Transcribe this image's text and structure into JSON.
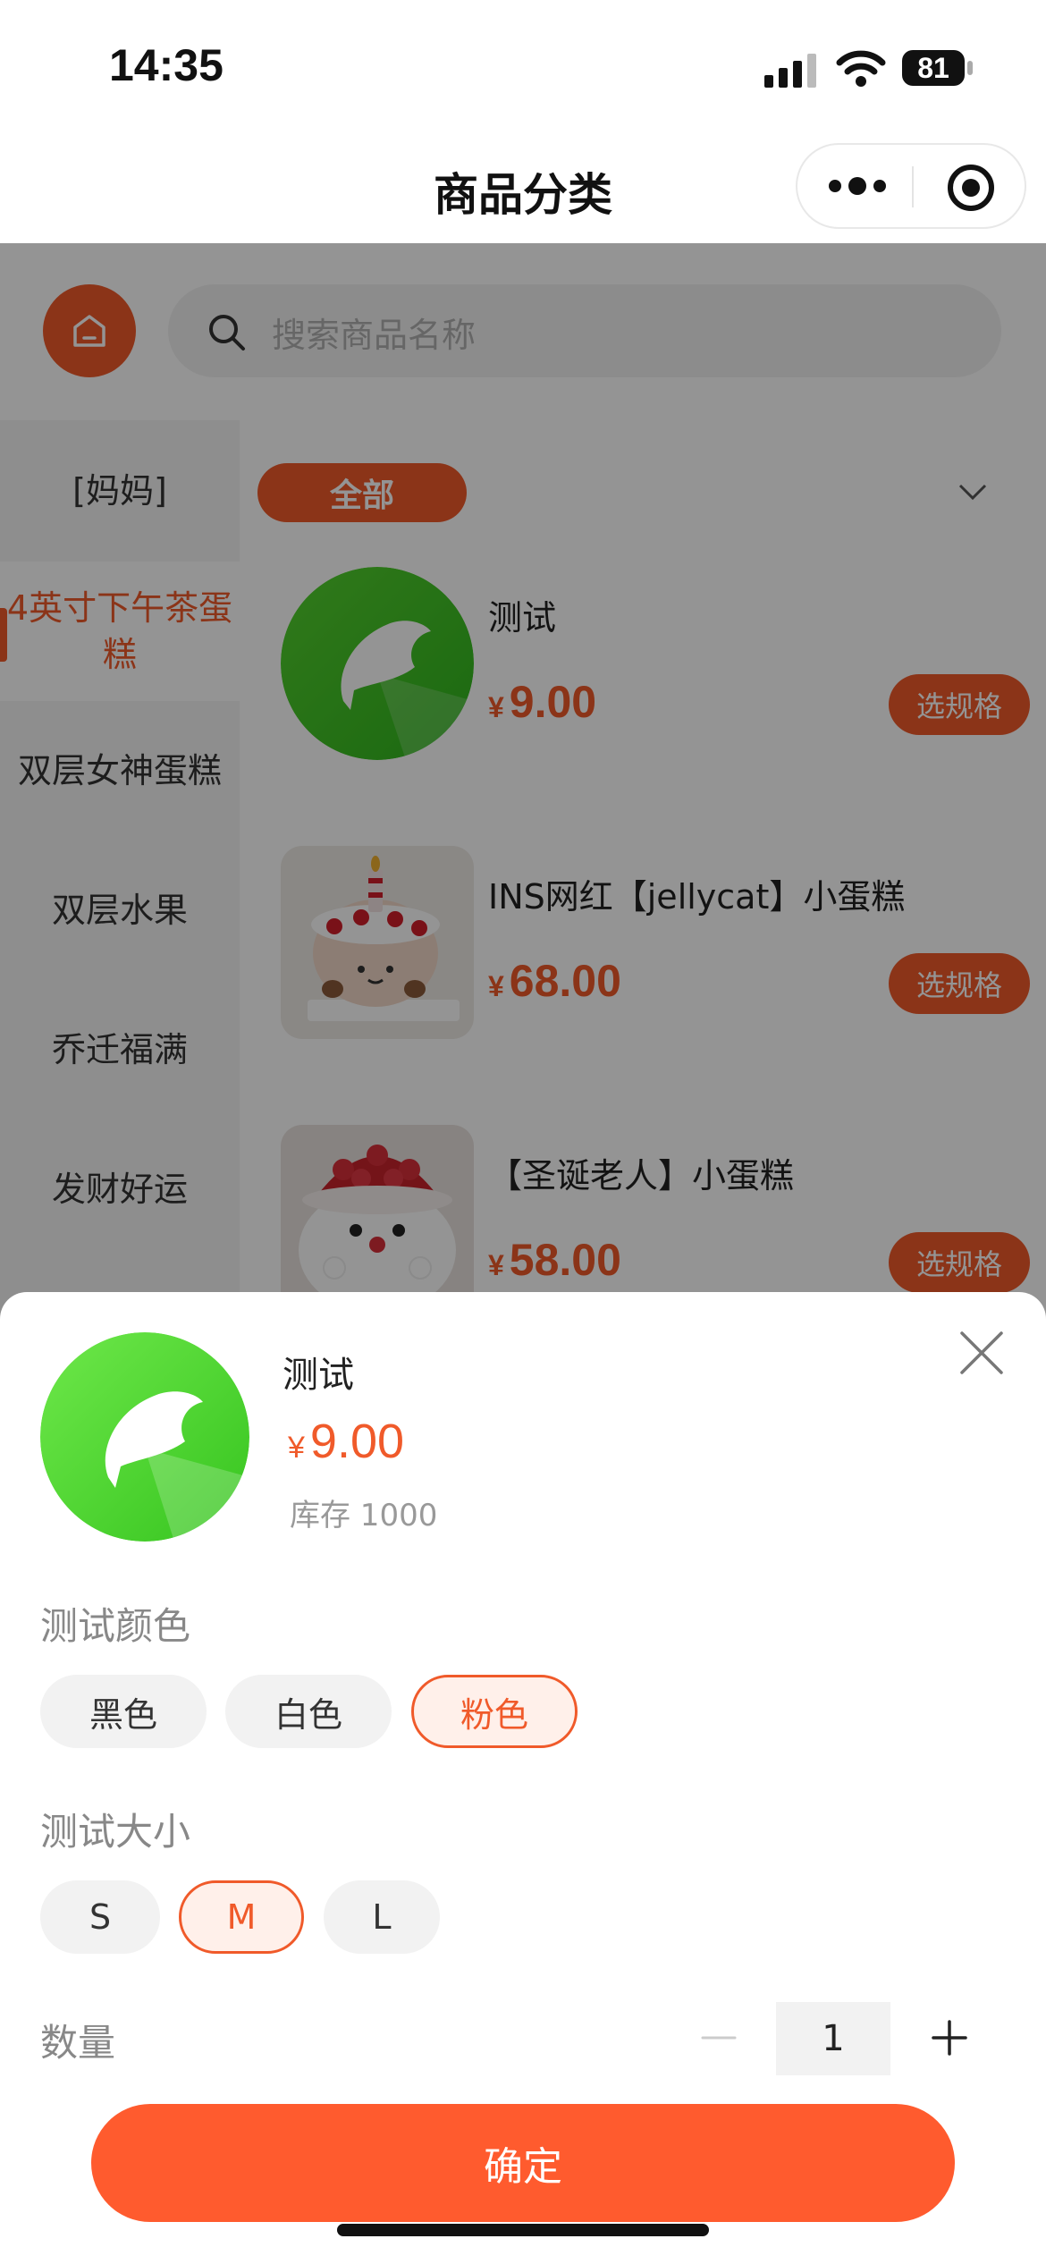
{
  "status_bar": {
    "time": "14:35",
    "battery": "81"
  },
  "nav": {
    "title": "商品分类"
  },
  "search": {
    "placeholder": "搜索商品名称"
  },
  "sidebar": {
    "items": [
      {
        "label": "[妈妈]"
      },
      {
        "label": "4英寸下午茶蛋糕"
      },
      {
        "label": "双层女神蛋糕"
      },
      {
        "label": "双层水果"
      },
      {
        "label": "乔迁福满"
      },
      {
        "label": "发财好运"
      }
    ]
  },
  "filter": {
    "all_label": "全部"
  },
  "products": [
    {
      "name": "测试",
      "currency": "¥",
      "price": "9.00",
      "button": "选规格"
    },
    {
      "name": "INS网红【jellycat】小蛋糕",
      "currency": "¥",
      "price": "68.00",
      "button": "选规格"
    },
    {
      "name": "【圣诞老人】小蛋糕",
      "currency": "¥",
      "price": "58.00",
      "button": "选规格"
    }
  ],
  "sheet": {
    "name": "测试",
    "currency": "¥",
    "price": "9.00",
    "stock": "库存 1000",
    "color_group": {
      "title": "测试颜色",
      "options": [
        "黑色",
        "白色",
        "粉色"
      ],
      "selected": "粉色"
    },
    "size_group": {
      "title": "测试大小",
      "options": [
        "S",
        "M",
        "L"
      ],
      "selected": "M"
    },
    "quantity_label": "数量",
    "quantity": "1",
    "confirm": "确定"
  },
  "colors": {
    "accent": "#f05a2a",
    "confirm": "#ff5b2e"
  }
}
